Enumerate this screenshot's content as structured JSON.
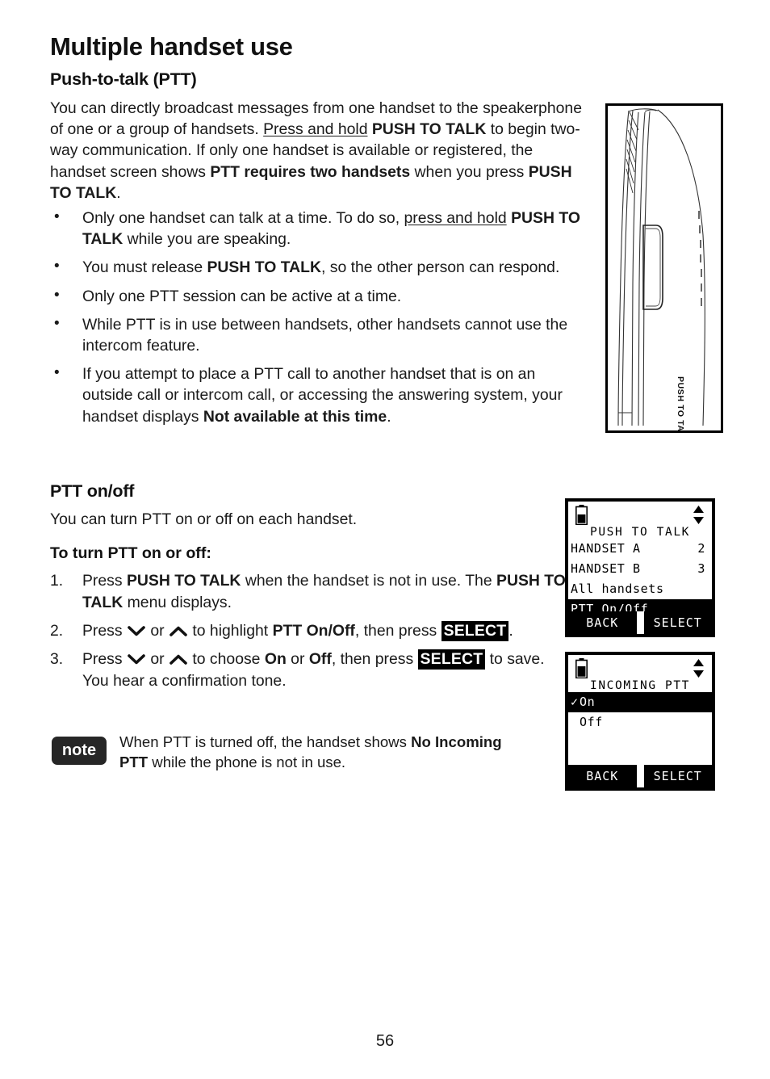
{
  "document": {
    "chapter_title": "Multiple handset use",
    "page_number": "56"
  },
  "section_ptt": {
    "heading": "Push-to-talk (PTT)",
    "intro": {
      "t1": "You can directly broadcast messages from one handset to the speakerphone of one or a group of handsets. ",
      "u1": "Press and hold",
      "t2": " ",
      "b1": "PUSH TO TALK",
      "t3": " to begin two-way communication. If only one handset is available or registered, the handset screen shows ",
      "b2": "PTT requires two handsets",
      "t4": " when you press ",
      "b3": "PUSH TO TALK",
      "t5": "."
    },
    "bullets": [
      {
        "marker": "•",
        "t1": "Only one handset can talk at a time. To do so, ",
        "u1": "press and hold",
        "t2": " ",
        "b1": "PUSH TO TALK",
        "t3": " while you are speaking."
      },
      {
        "marker": "•",
        "t1": "You must release ",
        "b1": "PUSH TO TALK",
        "t2": ", so the other person can respond."
      },
      {
        "marker": "•",
        "t1": "Only one PTT session can be active at a time."
      },
      {
        "marker": "•",
        "t1": "While PTT is in use between handsets, other handsets cannot use the intercom feature."
      },
      {
        "marker": "•",
        "t1": "If you attempt to place a PTT call to another handset that is on an outside call or intercom call, or accessing the answering system, your handset displays ",
        "b1": "Not available at this time",
        "t2": "."
      }
    ]
  },
  "section_onoff": {
    "heading": "PTT on/off",
    "description": "You can turn PTT on or off on each handset.",
    "steps_heading": "To turn PTT on or off:",
    "steps": [
      {
        "num": "1.",
        "t1": "Press ",
        "b1": "PUSH TO TALK",
        "t2": " when the handset is not in use. The ",
        "b2": "PUSH TO TALK",
        "t3": " menu displays."
      },
      {
        "num": "2.",
        "t1": "Press ",
        "icon_down": "chevron-down-icon",
        "t2": " or ",
        "icon_up": "chevron-up-icon",
        "t3": " to highlight ",
        "b1": "PTT On/Off",
        "t4": ", then press ",
        "key1": "SELECT",
        "t5": "."
      },
      {
        "num": "3.",
        "t1": "Press ",
        "icon_down": "chevron-down-icon",
        "t2": " or ",
        "icon_up": "chevron-up-icon",
        "t3": " to choose ",
        "b1": "On",
        "t4": " or ",
        "b2": "Off",
        "t5": ", then press ",
        "key1": "SELECT",
        "t6": " to save. You hear a confirmation tone."
      }
    ],
    "note": {
      "badge": "note",
      "t1": "When PTT is turned off, the handset shows ",
      "b1": "No Incoming PTT",
      "t2": " while the phone is not in use."
    }
  },
  "illustration": {
    "name": "handset-side-view",
    "button_label": "PUSH TO TALK"
  },
  "lcd_menu": {
    "name": "push-to-talk-menu-screen",
    "battery_icon": "battery-icon",
    "scroll_icon": "scroll-up-down-icon",
    "title": "PUSH TO TALK",
    "rows": [
      {
        "label": "HANDSET A",
        "value": "2",
        "highlighted": false,
        "check": ""
      },
      {
        "label": "HANDSET B",
        "value": "3",
        "highlighted": false,
        "check": ""
      },
      {
        "label": "All handsets",
        "value": "",
        "highlighted": false,
        "check": ""
      },
      {
        "label": "PTT On/Off",
        "value": "",
        "highlighted": true,
        "check": ""
      }
    ],
    "softkey_left": "BACK",
    "softkey_right": "SELECT"
  },
  "lcd_incoming": {
    "name": "incoming-ptt-screen",
    "battery_icon": "battery-icon",
    "scroll_icon": "scroll-up-down-icon",
    "title": "INCOMING PTT",
    "rows": [
      {
        "label": "On",
        "value": "",
        "highlighted": true,
        "check": "✓"
      },
      {
        "label": "Off",
        "value": "",
        "highlighted": false,
        "check": ""
      }
    ],
    "softkey_left": "BACK",
    "softkey_right": "SELECT"
  },
  "colors": {
    "ink": "#1a1a1a",
    "lcd_highlight": "#000000",
    "note_badge": "#262626"
  }
}
